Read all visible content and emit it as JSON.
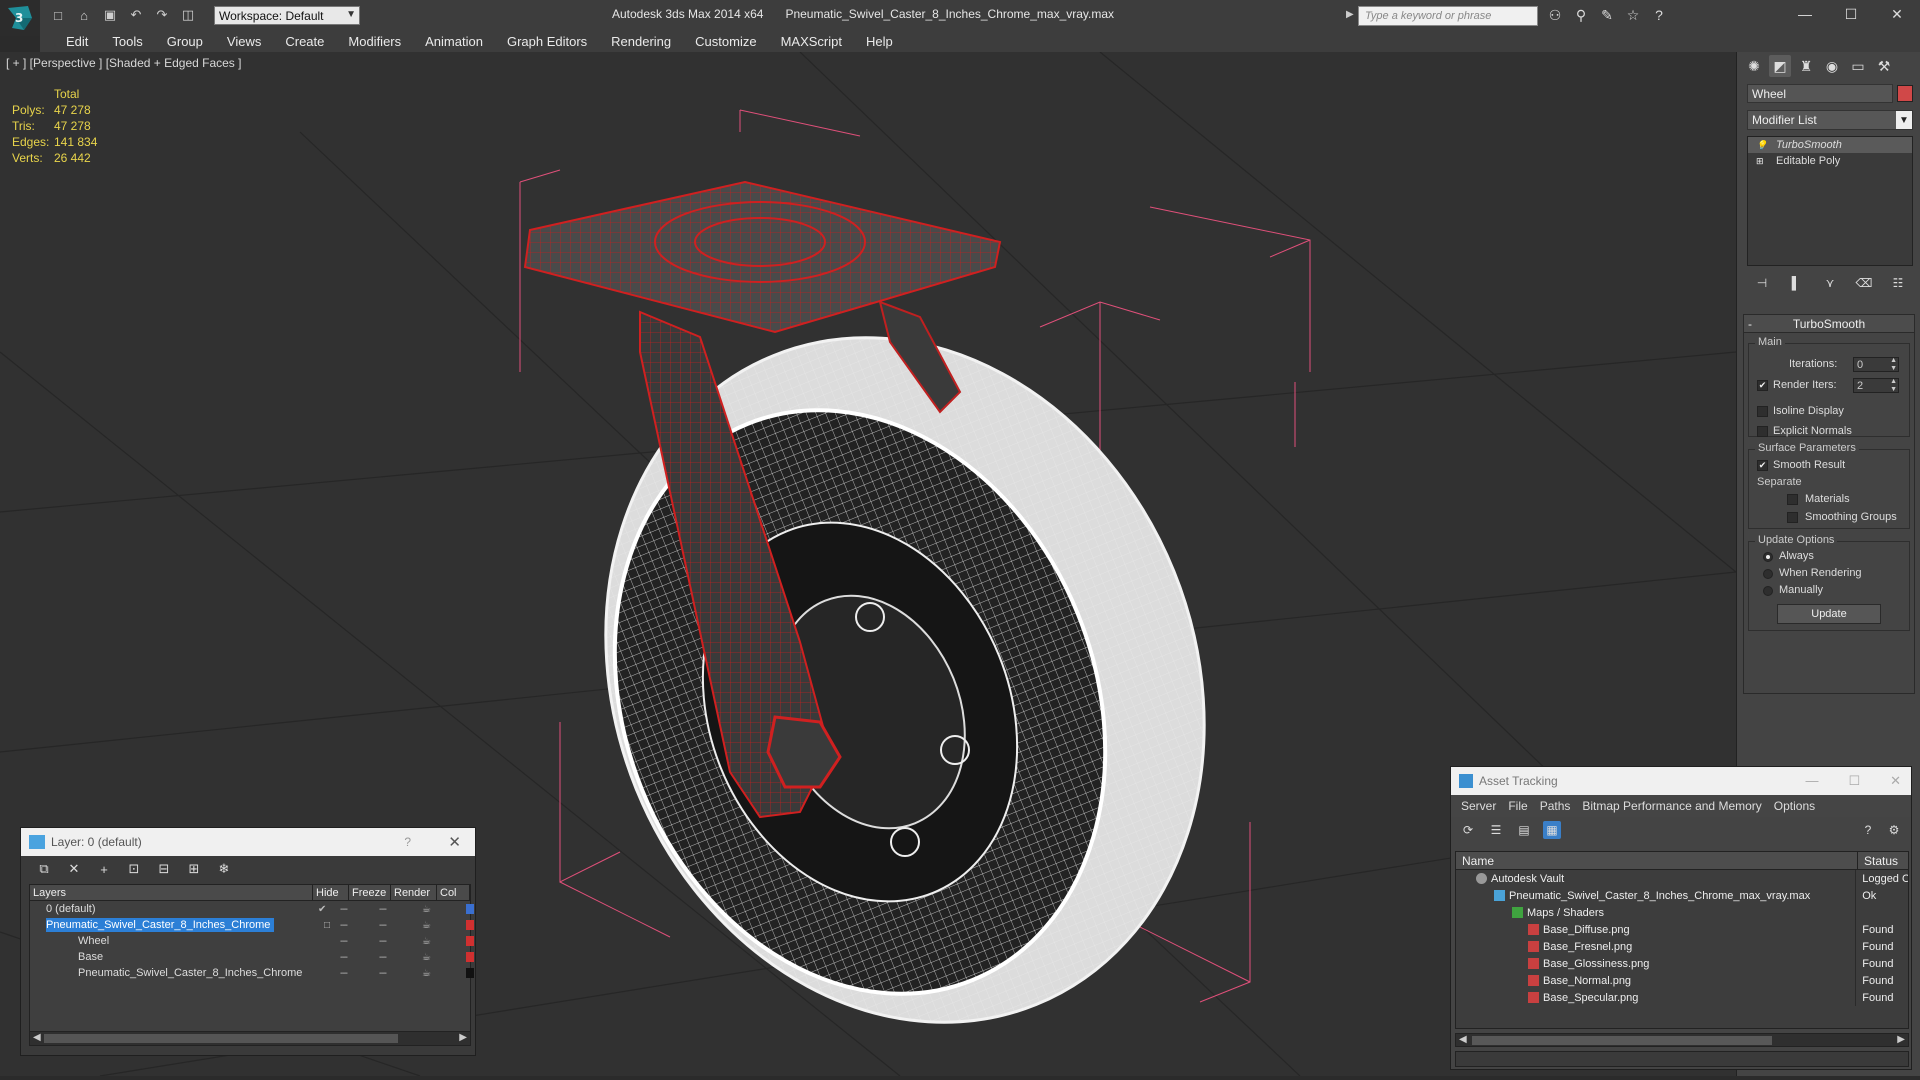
{
  "window": {
    "app_title": "Autodesk 3ds Max  2014 x64",
    "file_title": "Pneumatic_Swivel_Caster_8_Inches_Chrome_max_vray.max",
    "workspace": "Workspace: Default",
    "search_placeholder": "Type a keyword or phrase"
  },
  "menu": [
    "Edit",
    "Tools",
    "Group",
    "Views",
    "Create",
    "Modifiers",
    "Animation",
    "Graph Editors",
    "Rendering",
    "Customize",
    "MAXScript",
    "Help"
  ],
  "viewport": {
    "label": "[ + ] [Perspective ] [Shaded + Edged Faces ]",
    "stats": {
      "header": "Total",
      "rows": [
        {
          "k": "Polys:",
          "v": "47 278"
        },
        {
          "k": "Tris:",
          "v": "47 278"
        },
        {
          "k": "Edges:",
          "v": "141 834"
        },
        {
          "k": "Verts:",
          "v": "26 442"
        }
      ]
    }
  },
  "command_panel": {
    "object_name": "Wheel",
    "object_color": "#d04848",
    "modifier_list": "Modifier List",
    "stack": [
      "TurboSmooth",
      "Editable Poly"
    ],
    "turbosmooth": {
      "title": "TurboSmooth",
      "main": "Main",
      "iterations_label": "Iterations:",
      "iterations_value": "0",
      "render_iters_label": "Render Iters:",
      "render_iters_value": "2",
      "isoline": "Isoline Display",
      "explicit": "Explicit Normals",
      "surface": "Surface Parameters",
      "smooth_result": "Smooth Result",
      "separate": "Separate",
      "materials": "Materials",
      "smoothing_groups": "Smoothing Groups",
      "update_options": "Update Options",
      "always": "Always",
      "when_rendering": "When Rendering",
      "manually": "Manually",
      "update": "Update"
    }
  },
  "layer_window": {
    "title": "Layer: 0 (default)",
    "help": "?",
    "columns": [
      "Layers",
      "Hide",
      "Freeze",
      "Render",
      "Col"
    ],
    "rows": [
      {
        "name": "0 (default)",
        "indent": 0,
        "selected": false,
        "color": "#3a6fd0"
      },
      {
        "name": "Pneumatic_Swivel_Caster_8_Inches_Chrome",
        "indent": 0,
        "selected": true,
        "color": "#d03030"
      },
      {
        "name": "Wheel",
        "indent": 1,
        "selected": false,
        "color": "#d03030"
      },
      {
        "name": "Base",
        "indent": 1,
        "selected": false,
        "color": "#d03030"
      },
      {
        "name": "Pneumatic_Swivel_Caster_8_Inches_Chrome",
        "indent": 1,
        "selected": false,
        "color": "#111111"
      }
    ]
  },
  "asset_window": {
    "title": "Asset Tracking",
    "menu": [
      "Server",
      "File",
      "Paths",
      "Bitmap Performance and Memory",
      "Options"
    ],
    "columns": [
      "Name",
      "Status"
    ],
    "rows": [
      {
        "name": "Autodesk Vault",
        "indent": 1,
        "status": "Logged O",
        "icon": "vault"
      },
      {
        "name": "Pneumatic_Swivel_Caster_8_Inches_Chrome_max_vray.max",
        "indent": 2,
        "status": "Ok",
        "icon": "max"
      },
      {
        "name": "Maps / Shaders",
        "indent": 3,
        "status": "",
        "icon": "maps"
      },
      {
        "name": "Base_Diffuse.png",
        "indent": 4,
        "status": "Found",
        "icon": "png"
      },
      {
        "name": "Base_Fresnel.png",
        "indent": 4,
        "status": "Found",
        "icon": "png"
      },
      {
        "name": "Base_Glossiness.png",
        "indent": 4,
        "status": "Found",
        "icon": "png"
      },
      {
        "name": "Base_Normal.png",
        "indent": 4,
        "status": "Found",
        "icon": "png"
      },
      {
        "name": "Base_Specular.png",
        "indent": 4,
        "status": "Found",
        "icon": "png"
      }
    ]
  }
}
